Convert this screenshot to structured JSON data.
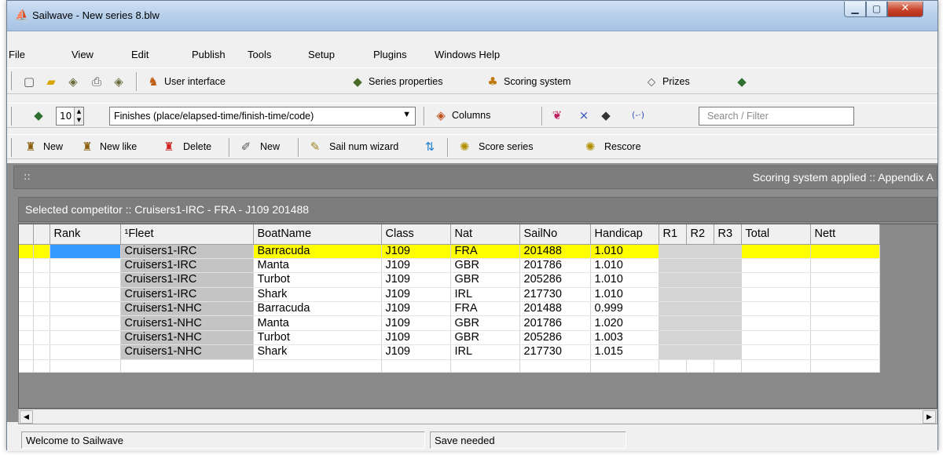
{
  "window": {
    "title": "Sailwave - New series 8.blw",
    "app_icon": "sailboat-icon"
  },
  "menubar": [
    "File",
    "View",
    "Edit",
    "Publish",
    "Tools",
    "Setup",
    "Plugins",
    "Windows Help"
  ],
  "toolbar1": {
    "user_interface": "User interface",
    "series_properties": "Series properties",
    "scoring_system": "Scoring system",
    "prizes": "Prizes"
  },
  "toolbar2": {
    "spin_value": "10",
    "view_select": "Finishes (place/elapsed-time/finish-time/code)",
    "columns": "Columns",
    "clear_symbol": "×",
    "link_symbol": "(-·)",
    "search_placeholder": "Search / Filter"
  },
  "toolbar3": {
    "new": "New",
    "new_like": "New like",
    "delete": "Delete",
    "new_race": "New",
    "sail_num_wizard": "Sail num wizard",
    "score_series": "Score series",
    "rescore": "Rescore"
  },
  "scoring_bar": {
    "marker": "::",
    "text": "Scoring system applied :: Appendix A"
  },
  "selected_bar": {
    "text": "Selected competitor :: Cruisers1-IRC - FRA - J109 201488"
  },
  "grid": {
    "columns": [
      "Rank",
      "¹Fleet",
      "BoatName",
      "Class",
      "Nat",
      "SailNo",
      "Handicap",
      "R1",
      "R2",
      "R3",
      "Total",
      "Nett"
    ],
    "rows": [
      {
        "fleet": "Cruisers1-IRC",
        "boat": "Barracuda",
        "class": "J109",
        "nat": "FRA",
        "sailno": "201488",
        "handicap": "1.010"
      },
      {
        "fleet": "Cruisers1-IRC",
        "boat": "Manta",
        "class": "J109",
        "nat": "GBR",
        "sailno": "201786",
        "handicap": "1.010"
      },
      {
        "fleet": "Cruisers1-IRC",
        "boat": "Turbot",
        "class": "J109",
        "nat": "GBR",
        "sailno": "205286",
        "handicap": "1.010"
      },
      {
        "fleet": "Cruisers1-IRC",
        "boat": "Shark",
        "class": "J109",
        "nat": "IRL",
        "sailno": "217730",
        "handicap": "1.010"
      },
      {
        "fleet": "Cruisers1-NHC",
        "boat": "Barracuda",
        "class": "J109",
        "nat": "FRA",
        "sailno": "201488",
        "handicap": "0.999"
      },
      {
        "fleet": "Cruisers1-NHC",
        "boat": "Manta",
        "class": "J109",
        "nat": "GBR",
        "sailno": "201786",
        "handicap": "1.020"
      },
      {
        "fleet": "Cruisers1-NHC",
        "boat": "Turbot",
        "class": "J109",
        "nat": "GBR",
        "sailno": "205286",
        "handicap": "1.003"
      },
      {
        "fleet": "Cruisers1-NHC",
        "boat": "Shark",
        "class": "J109",
        "nat": "IRL",
        "sailno": "217730",
        "handicap": "1.015"
      }
    ]
  },
  "status": {
    "left": "Welcome to Sailwave",
    "right": "Save needed"
  },
  "colors": {
    "selected_row": "#ffff00",
    "rank_highlight": "#3399ff",
    "panel_grey": "#7d7d7d"
  }
}
